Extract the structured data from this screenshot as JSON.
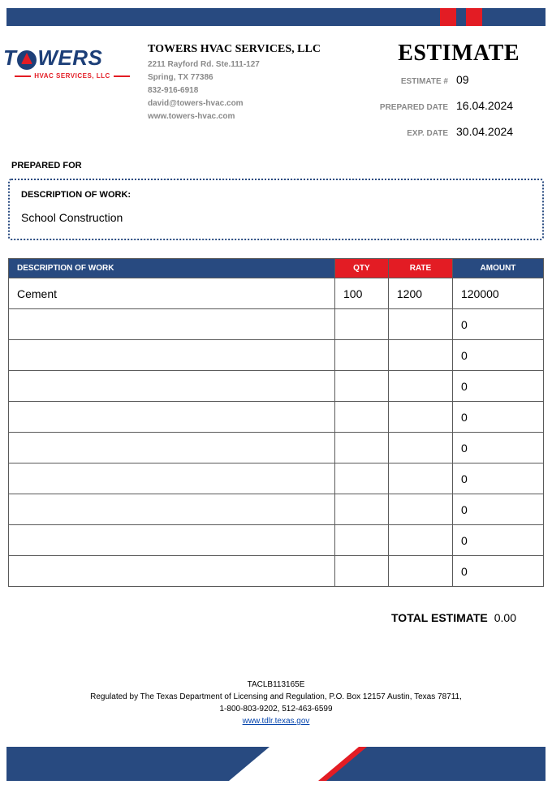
{
  "logo": {
    "word_left": "T",
    "word_right": "WERS",
    "sub": "HVAC SERVICES, LLC"
  },
  "company": {
    "name": "TOWERS HVAC SERVICES, LLC",
    "addr1": "2211 Rayford Rd. Ste.111-127",
    "addr2": "Spring, TX 77386",
    "phone": "832-916-6918",
    "email": "david@towers-hvac.com",
    "web": "www.towers-hvac.com"
  },
  "estimate": {
    "title": "ESTIMATE",
    "num_label": "ESTIMATE #",
    "num": "09",
    "prepared_label": "PREPARED DATE",
    "prepared": "16.04.2024",
    "exp_label": "EXP. DATE",
    "exp": "30.04.2024"
  },
  "prepared_for_label": "PREPARED FOR",
  "description_box": {
    "label": "DESCRIPTION OF WORK:",
    "value": "School Construction"
  },
  "table": {
    "headers": {
      "desc": "DESCRIPTION OF WORK",
      "qty": "QTY",
      "rate": "RATE",
      "amount": "AMOUNT"
    },
    "rows": [
      {
        "desc": "Cement",
        "qty": "100",
        "rate": "1200",
        "amount": "120000"
      },
      {
        "desc": "",
        "qty": "",
        "rate": "",
        "amount": "0"
      },
      {
        "desc": "",
        "qty": "",
        "rate": "",
        "amount": "0"
      },
      {
        "desc": "",
        "qty": "",
        "rate": "",
        "amount": "0"
      },
      {
        "desc": "",
        "qty": "",
        "rate": "",
        "amount": "0"
      },
      {
        "desc": "",
        "qty": "",
        "rate": "",
        "amount": "0"
      },
      {
        "desc": "",
        "qty": "",
        "rate": "",
        "amount": "0"
      },
      {
        "desc": "",
        "qty": "",
        "rate": "",
        "amount": "0"
      },
      {
        "desc": "",
        "qty": "",
        "rate": "",
        "amount": "0"
      },
      {
        "desc": "",
        "qty": "",
        "rate": "",
        "amount": "0"
      }
    ]
  },
  "total": {
    "label": "TOTAL ESTIMATE",
    "value": "0.00"
  },
  "footer": {
    "line1": "TACLB113165E",
    "line2": "Regulated by The Texas Department of Licensing and Regulation, P.O. Box 12157 Austin, Texas 78711,",
    "line3": "1-800-803-9202, 512-463-6599",
    "link": "www.tdlr.texas.gov"
  }
}
